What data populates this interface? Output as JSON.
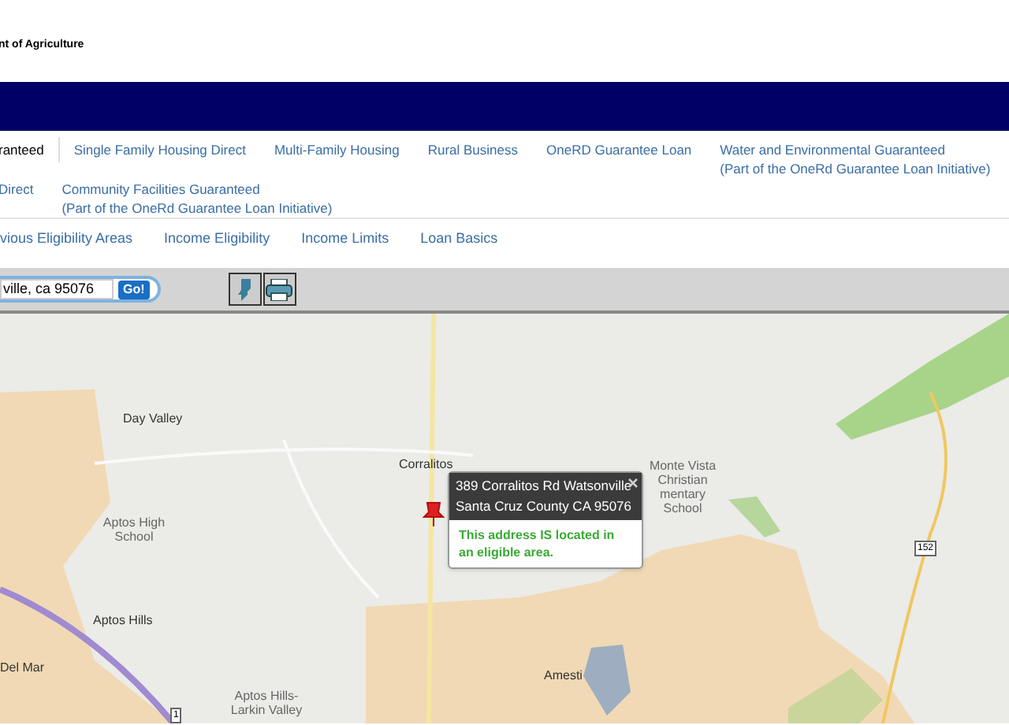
{
  "header": {
    "agency": "nt of Agriculture"
  },
  "program_tabs": [
    [
      {
        "label": "ranteed",
        "selected": true
      },
      {
        "label": "Single Family Housing Direct",
        "selected": false
      },
      {
        "label": "Multi-Family Housing",
        "selected": false
      },
      {
        "label": "Rural Business",
        "selected": false
      },
      {
        "label": "OneRD Guarantee Loan",
        "selected": false
      },
      {
        "label": "Water and Environmental Guaranteed",
        "note": "(Part of the OneRd Guarantee Loan Initiative)",
        "selected": false
      }
    ],
    [
      {
        "label": "Direct",
        "selected": false
      },
      {
        "label": "Community Facilities Guaranteed",
        "note": "(Part of the OneRd Guarantee Loan Initiative)",
        "selected": false
      }
    ]
  ],
  "sub_tabs": [
    {
      "label": "vious Eligibility Areas"
    },
    {
      "label": "Income Eligibility"
    },
    {
      "label": "Income Limits"
    },
    {
      "label": "Loan Basics"
    }
  ],
  "toolbar": {
    "search_value": "ville, ca 95076",
    "go_label": "Go!"
  },
  "map": {
    "labels": [
      {
        "text": "Day Valley"
      },
      {
        "text": "Corralitos"
      },
      {
        "text": "Aptos High School",
        "kind": "poi"
      },
      {
        "text": "Monte Vista Christian mentary School",
        "kind": "poi"
      },
      {
        "text": "Aptos Hills"
      },
      {
        "text": "Del Mar"
      },
      {
        "text": "Amesti"
      },
      {
        "text": "Aptos Hills-Larkin Valley",
        "kind": "poi"
      },
      {
        "text": "152",
        "kind": "shield"
      },
      {
        "text": "1",
        "kind": "shield"
      }
    ],
    "popup": {
      "address": "389 Corralitos Rd Watsonville",
      "county": "Santa Cruz County CA 95076",
      "result": "This address IS located in an eligible area.",
      "eligible": true
    }
  }
}
